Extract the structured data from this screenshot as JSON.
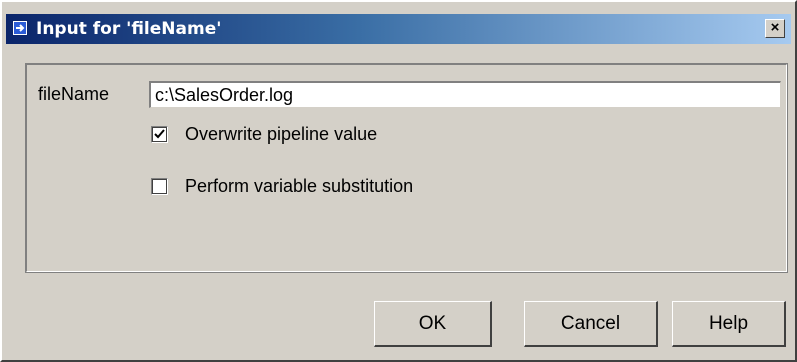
{
  "window": {
    "title": "Input for 'fileName'",
    "close_label": "×"
  },
  "form": {
    "field_label": "fileName",
    "field_value": "c:\\SalesOrder.log",
    "options": [
      {
        "label": "Overwrite pipeline value",
        "checked": true
      },
      {
        "label": "Perform variable substitution",
        "checked": false
      }
    ]
  },
  "buttons": {
    "ok": "OK",
    "cancel": "Cancel",
    "help": "Help"
  },
  "colors": {
    "titlebar_start": "#0a246a",
    "titlebar_end": "#a6caf0",
    "dialog_bg": "#d4d0c8"
  },
  "icons": {
    "title_icon": "arrow-right-icon",
    "close_icon": "close-icon",
    "check_icon": "checkmark-icon"
  }
}
